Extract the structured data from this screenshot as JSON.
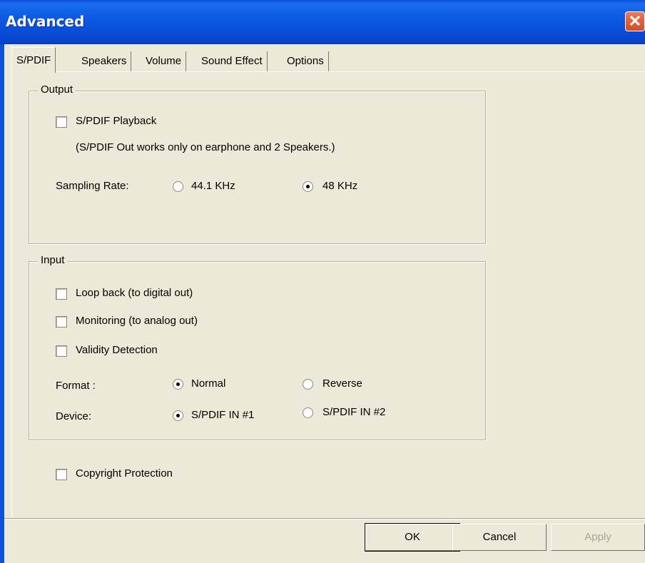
{
  "window": {
    "title": "Advanced",
    "close_glyph": "✕"
  },
  "tabs": [
    "S/PDIF",
    "Speakers",
    "Volume",
    "Sound Effect",
    "Options"
  ],
  "active_tab": "S/PDIF",
  "output": {
    "title": "Output",
    "playback_label": "S/PDIF Playback",
    "playback_checked": false,
    "note": "(S/PDIF Out works only on earphone and 2 Speakers.)",
    "sampling_label": "Sampling Rate:",
    "rates": [
      {
        "label": "44.1 KHz",
        "checked": false
      },
      {
        "label": "48 KHz",
        "checked": true
      }
    ]
  },
  "input": {
    "title": "Input",
    "loopback_label": "Loop back (to digital out)",
    "monitoring_label": "Monitoring (to analog out)",
    "validity_label": "Validity Detection",
    "format_label": "Format :",
    "formats": [
      {
        "label": "Normal",
        "checked": true
      },
      {
        "label": "Reverse",
        "checked": false
      }
    ],
    "device_label": "Device:",
    "devices": [
      {
        "label": "S/PDIF IN #1",
        "checked": true
      },
      {
        "label": "S/PDIF IN #2",
        "checked": false
      }
    ]
  },
  "copyright_label": "Copyright Protection",
  "buttons": {
    "ok": "OK",
    "cancel": "Cancel",
    "apply": "Apply"
  },
  "colors": {
    "titlebar": "#0b58e3",
    "dialog_bg": "#ece9d8",
    "close_button": "#d74a26"
  }
}
